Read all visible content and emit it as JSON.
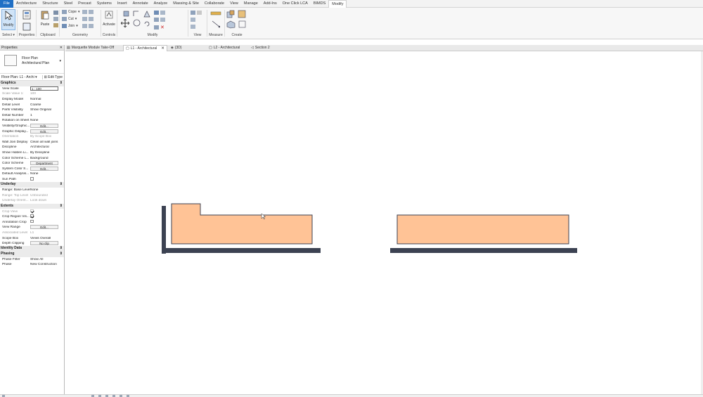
{
  "menu": {
    "tabs": [
      "File",
      "Architecture",
      "Structure",
      "Steel",
      "Precast",
      "Systems",
      "Insert",
      "Annotate",
      "Analyze",
      "Massing & Site",
      "Collaborate",
      "View",
      "Manage",
      "Add-Ins",
      "One Click LCA",
      "BIMDS",
      "Modify"
    ],
    "active": "Modify"
  },
  "ribbon": {
    "modify_label": "Modify",
    "select_label": "Select",
    "properties_label": "Properties",
    "paste_label": "Paste",
    "clipboard_label": "Clipboard",
    "cope_label": "Cope",
    "cut_label": "Cut",
    "join_label": "Join",
    "geometry_label": "Geometry",
    "activate_label": "Activate",
    "controls_label": "Controls",
    "modify_panel_label": "Modify",
    "view_label": "View",
    "measure_label": "Measure",
    "create_label": "Create"
  },
  "properties": {
    "title": "Properties",
    "type_name_line1": "Floor Plan",
    "type_name_line2": "Architectural Plan",
    "instance_selector": "Floor Plan: L1 - Archi",
    "edit_type": "Edit Type",
    "sections": [
      {
        "name": "Graphics",
        "rows": [
          {
            "k": "View Scale",
            "v": "1 : 100",
            "kind": "field"
          },
          {
            "k": "Scale Value   1:",
            "v": "100",
            "kind": "text",
            "dim": true
          },
          {
            "k": "Display Model",
            "v": "Normal",
            "kind": "text"
          },
          {
            "k": "Detail Level",
            "v": "Coarse",
            "kind": "text"
          },
          {
            "k": "Parts Visibility",
            "v": "Show Original",
            "kind": "text"
          },
          {
            "k": "Detail Number",
            "v": "1",
            "kind": "text"
          },
          {
            "k": "Rotation on Sheet",
            "v": "None",
            "kind": "text"
          },
          {
            "k": "Visibility/Graphic...",
            "v": "Edit...",
            "kind": "button"
          },
          {
            "k": "Graphic Display...",
            "v": "Edit...",
            "kind": "button"
          },
          {
            "k": "Orientation",
            "v": "By Scope Box",
            "kind": "text",
            "dim": true
          },
          {
            "k": "Wall Join Display",
            "v": "Clean all wall joins",
            "kind": "text"
          },
          {
            "k": "Discipline",
            "v": "Architectural",
            "kind": "text"
          },
          {
            "k": "Show Hidden Li...",
            "v": "By Discipline",
            "kind": "text"
          },
          {
            "k": "Color Scheme L...",
            "v": "Background",
            "kind": "text"
          },
          {
            "k": "Color Scheme",
            "v": "Department",
            "kind": "button"
          },
          {
            "k": "System Color S...",
            "v": "Edit...",
            "kind": "button"
          },
          {
            "k": "Default Analysis...",
            "v": "None",
            "kind": "text"
          },
          {
            "k": "Sun Path",
            "v": "",
            "kind": "check",
            "checked": false
          }
        ]
      },
      {
        "name": "Underlay",
        "rows": [
          {
            "k": "Range: Base Level",
            "v": "None",
            "kind": "text"
          },
          {
            "k": "Range: Top Level",
            "v": "Unbounded",
            "kind": "text",
            "dim": true
          },
          {
            "k": "Underlay Orient...",
            "v": "Look down",
            "kind": "text",
            "dim": true
          }
        ]
      },
      {
        "name": "Extents",
        "rows": [
          {
            "k": "Crop View",
            "v": "",
            "kind": "check",
            "checked": true,
            "dim": true
          },
          {
            "k": "Crop Region Vis...",
            "v": "",
            "kind": "check",
            "checked": true
          },
          {
            "k": "Annotation Crop",
            "v": "",
            "kind": "check",
            "checked": false
          },
          {
            "k": "View Range",
            "v": "Edit...",
            "kind": "button"
          },
          {
            "k": "Associated Level",
            "v": "L1",
            "kind": "text",
            "dim": true
          },
          {
            "k": "Scope Box",
            "v": "Views Overall",
            "kind": "text"
          },
          {
            "k": "Depth Clipping",
            "v": "No clip",
            "kind": "button"
          }
        ]
      },
      {
        "name": "Identity Data",
        "rows": []
      },
      {
        "name": "Phasing",
        "rows": [
          {
            "k": "Phase Filter",
            "v": "Show All",
            "kind": "text"
          },
          {
            "k": "Phase",
            "v": "New Construction",
            "kind": "text"
          }
        ]
      }
    ]
  },
  "view_tabs": [
    {
      "label": "Marquette Module Take-Off",
      "active": false
    },
    {
      "label": "L1 - Architectural",
      "active": true
    },
    {
      "label": "{3D}",
      "active": false
    },
    {
      "label": "L2 - Architectural",
      "active": false
    },
    {
      "label": "Section 2",
      "active": false
    }
  ],
  "colors": {
    "room_fill": "#ffc396",
    "wall_dark": "#3c4252",
    "file_tab": "#1f6fc5"
  }
}
